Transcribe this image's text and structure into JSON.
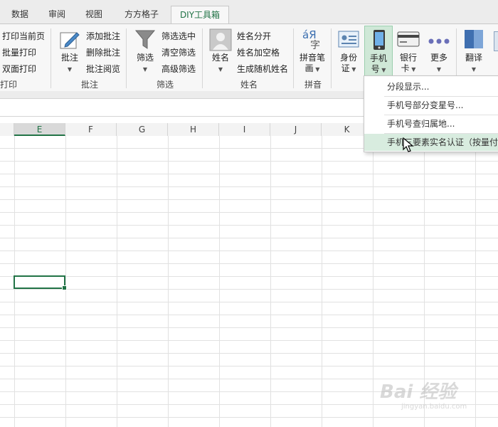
{
  "tabs": [
    {
      "label": "数据"
    },
    {
      "label": "审阅"
    },
    {
      "label": "视图"
    },
    {
      "label": "方方格子"
    },
    {
      "label": "DIY工具箱"
    }
  ],
  "ribbon": {
    "print": {
      "items": [
        "打印当前页",
        "批量打印",
        "双面打印"
      ],
      "group": "打印"
    },
    "comment": {
      "big": "批注",
      "items": [
        "添加批注",
        "删除批注",
        "批注阅览"
      ],
      "group": "批注"
    },
    "filter": {
      "big": "筛选",
      "items": [
        "筛选选中",
        "清空筛选",
        "高级筛选"
      ],
      "group": "筛选"
    },
    "name": {
      "big": "姓名",
      "items": [
        "姓名分开",
        "姓名加空格",
        "生成随机姓名"
      ],
      "group": "姓名"
    },
    "pinyin": {
      "big_l1": "拼音笔",
      "big_l2": "画",
      "glyph_top": "áЯ",
      "glyph_bottom": "字",
      "group": "拼音"
    },
    "id": {
      "l1": "身份",
      "l2": "证"
    },
    "phone": {
      "l1": "手机",
      "l2": "号"
    },
    "bank": {
      "l1": "银行",
      "l2": "卡"
    },
    "more": {
      "l1": "更多"
    },
    "translate": {
      "l1": "翻译"
    }
  },
  "columns": [
    "E",
    "F",
    "G",
    "H",
    "I",
    "J",
    "K"
  ],
  "dropdown": {
    "items": [
      "分段显示...",
      "手机号部分变星号...",
      "手机号查归属地...",
      "手机三要素实名认证（按量付"
    ]
  },
  "watermark": {
    "line1": "Bai 经验",
    "line2": "jingyan.baidu.com"
  },
  "colors": {
    "accent": "#217346",
    "selected_bg": "#cfe8d7",
    "hover_bg": "#d8ecdf"
  }
}
